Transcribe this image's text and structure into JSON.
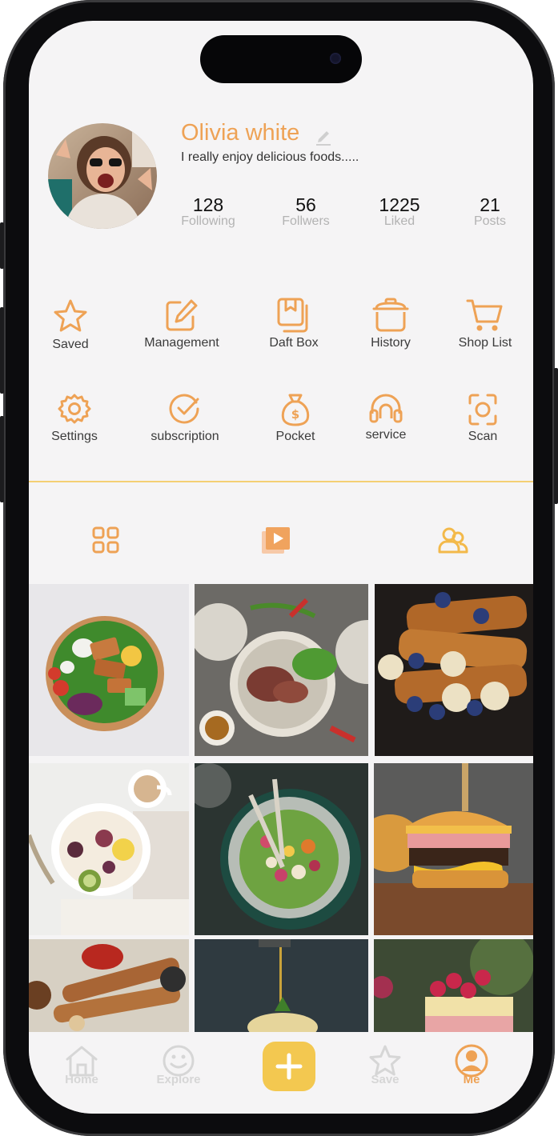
{
  "profile": {
    "name": "Olivia white",
    "bio": "I really enjoy delicious foods.....",
    "stats": [
      {
        "value": "128",
        "label": "Following"
      },
      {
        "value": "56",
        "label": "Follwers"
      },
      {
        "value": "1225",
        "label": "Liked"
      },
      {
        "value": "21",
        "label": "Posts"
      }
    ]
  },
  "menu_row1": [
    {
      "label": "Saved",
      "icon": "star-icon"
    },
    {
      "label": "Management",
      "icon": "edit-square-icon"
    },
    {
      "label": "Daft Box",
      "icon": "draft-box-icon"
    },
    {
      "label": "History",
      "icon": "pot-icon"
    },
    {
      "label": "Shop List",
      "icon": "cart-icon"
    }
  ],
  "menu_row2": [
    {
      "label": "Settings",
      "icon": "gear-icon"
    },
    {
      "label": "subscription",
      "icon": "check-circle-icon"
    },
    {
      "label": "Pocket",
      "icon": "money-bag-icon"
    },
    {
      "label": "service",
      "icon": "headset-icon"
    },
    {
      "label": "Scan",
      "icon": "scan-icon"
    }
  ],
  "content_tabs": [
    {
      "icon": "grid-icon"
    },
    {
      "icon": "video-icon"
    },
    {
      "icon": "users-icon"
    }
  ],
  "bottom_nav": [
    {
      "label": "Home",
      "icon": "home-icon"
    },
    {
      "label": "Explore",
      "icon": "smile-icon"
    },
    {
      "label": "",
      "icon": "plus-icon"
    },
    {
      "label": "Save",
      "icon": "star-icon"
    },
    {
      "label": "Me",
      "icon": "user-circle-icon",
      "active": true
    }
  ],
  "colors": {
    "accent": "#eea255",
    "yellow": "#f3c850",
    "background": "#f5f4f5",
    "divider": "#f4cf73",
    "inactive": "#d6d6d6"
  }
}
